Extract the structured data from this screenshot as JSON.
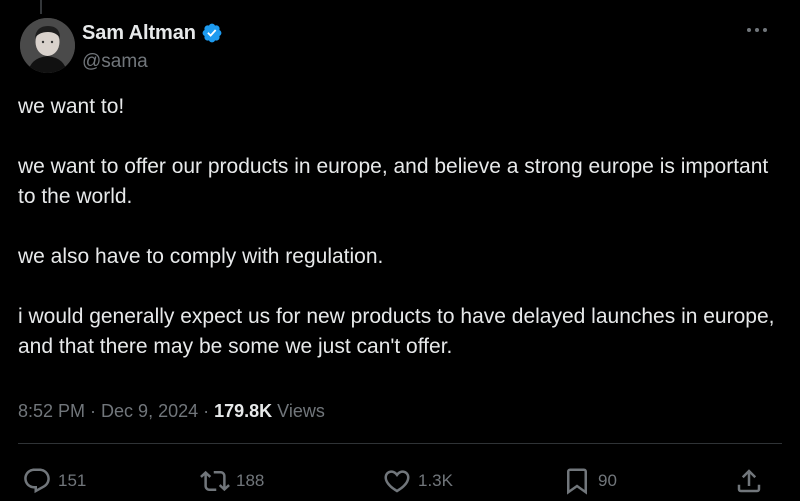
{
  "author": {
    "display_name": "Sam Altman",
    "handle": "@sama",
    "verified": true,
    "verified_color": "#1d9bf0",
    "avatar_icon": "profile-photo"
  },
  "tweet": {
    "paragraphs": [
      "we want to!",
      "we want to offer our products in europe, and believe a strong europe is important to the world.",
      "we also have to comply with regulation.",
      "i would generally expect us for new products to have delayed launches in europe, and that there may be some we just can't offer."
    ]
  },
  "meta": {
    "time": "8:52 PM",
    "separator": "·",
    "date": "Dec 9, 2024",
    "views_count": "179.8K",
    "views_label": "Views"
  },
  "actions": {
    "replies": "151",
    "reposts": "188",
    "likes": "1.3K",
    "bookmarks": "90"
  },
  "colors": {
    "background": "#000000",
    "text": "#e7e9ea",
    "muted": "#71767b",
    "divider": "#2f3336"
  }
}
